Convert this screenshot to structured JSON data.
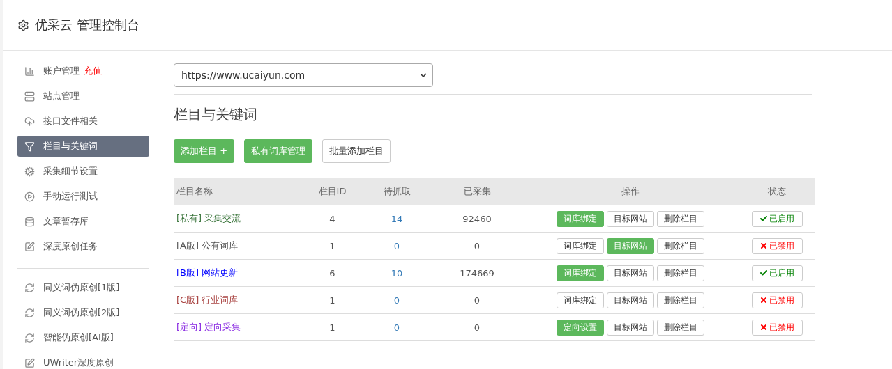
{
  "header": {
    "title": "优采云 管理控制台"
  },
  "sidebar": {
    "items": [
      {
        "kind": "chart",
        "label": "账户管理",
        "badge": "充值",
        "selected": false
      },
      {
        "kind": "server",
        "label": "站点管理",
        "selected": false
      },
      {
        "kind": "cloud",
        "label": "接口文件相关",
        "selected": false
      },
      {
        "kind": "filter",
        "label": "栏目与关键词",
        "selected": true
      },
      {
        "kind": "cogs",
        "label": "采集细节设置",
        "selected": false
      },
      {
        "kind": "play",
        "label": "手动运行测试",
        "selected": false
      },
      {
        "kind": "database",
        "label": "文章暂存库",
        "selected": false
      },
      {
        "kind": "edit",
        "label": "深度原创任务",
        "selected": false
      }
    ],
    "tools": [
      {
        "kind": "refresh",
        "label": "同义词伪原创[1版]"
      },
      {
        "kind": "refresh",
        "label": "同义词伪原创[2版]"
      },
      {
        "kind": "refresh",
        "label": "智能伪原创[AI版]"
      },
      {
        "kind": "edit",
        "label": "UWriter深度原创"
      }
    ]
  },
  "site_select": {
    "value": "https://www.ucaiyun.com"
  },
  "heading": "栏目与关键词",
  "actions": [
    {
      "label": "添加栏目 +",
      "primary": true
    },
    {
      "label": "私有词库管理",
      "primary": true
    },
    {
      "label": "批量添加栏目",
      "primary": false
    }
  ],
  "table": {
    "columns": [
      "栏目名称",
      "栏目ID",
      "待抓取",
      "已采集",
      "操作",
      "状态"
    ],
    "rows": [
      {
        "tag": "[私有]",
        "name": "采集交流",
        "color": "#3c763d",
        "id": "4",
        "pending": "14",
        "collected": "92460",
        "ops": [
          {
            "label": "词库绑定",
            "primary": true
          },
          {
            "label": "目标网站",
            "primary": false
          },
          {
            "label": "删除栏目",
            "primary": false
          }
        ],
        "status": {
          "label": "已启用",
          "enabled": true
        }
      },
      {
        "tag": "[A版]",
        "name": "公有词库",
        "color": "#555555",
        "id": "1",
        "pending": "0",
        "collected": "0",
        "ops": [
          {
            "label": "词库绑定",
            "primary": false
          },
          {
            "label": "目标网站",
            "primary": true
          },
          {
            "label": "删除栏目",
            "primary": false
          }
        ],
        "status": {
          "label": "已禁用",
          "enabled": false
        }
      },
      {
        "tag": "[B版]",
        "name": "网站更新",
        "color": "#0000ff",
        "id": "6",
        "pending": "10",
        "collected": "174669",
        "ops": [
          {
            "label": "词库绑定",
            "primary": true
          },
          {
            "label": "目标网站",
            "primary": false
          },
          {
            "label": "删除栏目",
            "primary": false
          }
        ],
        "status": {
          "label": "已启用",
          "enabled": true
        }
      },
      {
        "tag": "[C版]",
        "name": "行业词库",
        "color": "#a94442",
        "id": "1",
        "pending": "0",
        "collected": "0",
        "ops": [
          {
            "label": "词库绑定",
            "primary": false
          },
          {
            "label": "目标网站",
            "primary": false
          },
          {
            "label": "删除栏目",
            "primary": false
          }
        ],
        "status": {
          "label": "已禁用",
          "enabled": false
        }
      },
      {
        "tag": "[定向]",
        "name": "定向采集",
        "color": "#8a2be2",
        "id": "1",
        "pending": "0",
        "collected": "0",
        "ops": [
          {
            "label": "定向设置",
            "primary": true
          },
          {
            "label": "目标网站",
            "primary": false
          },
          {
            "label": "删除栏目",
            "primary": false
          }
        ],
        "status": {
          "label": "已禁用",
          "enabled": false
        }
      }
    ]
  }
}
